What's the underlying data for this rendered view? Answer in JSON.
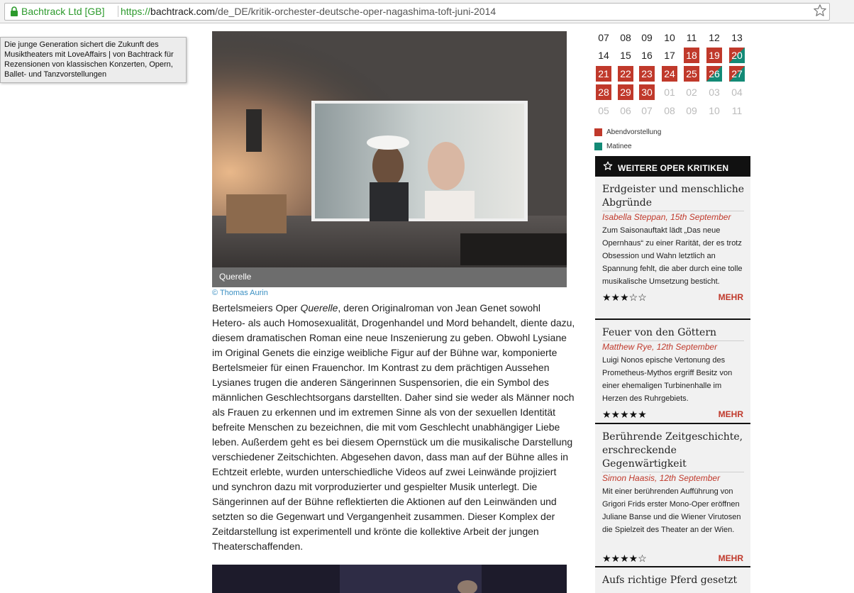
{
  "browser": {
    "ev_label": "Bachtrack Ltd [GB]",
    "url_scheme": "https://",
    "url_host": "bachtrack.com",
    "url_path": "/de_DE/kritik-orchester-deutsche-oper-nagashima-toft-juni-2014"
  },
  "tooltip": "Die junge Generation sichert die Zukunft des Musiktheaters mit LoveAffairs | von Bachtrack für Rezensionen von klassischen Konzerten, Opern, Ballet- und Tanzvorstellungen",
  "article": {
    "image_caption": "Querelle",
    "photo_credit": "© Thomas Aurin",
    "p_start": "Bertelsmeiers Oper ",
    "p_em": "Querelle",
    "p_rest": ", deren Originalroman von Jean Genet sowohl Hetero- als auch Homosexualität, Drogenhandel und Mord behandelt, diente dazu, diesem dramatischen Roman eine neue Inszenierung zu geben. Obwohl Lysiane im Original Genets die einzige weibliche Figur auf der Bühne war, komponierte Bertelsmeier für einen Frauenchor. Im Kontrast zu dem prächtigen Aussehen Lysianes trugen die anderen Sängerinnen Suspensorien, die ein Symbol des männlichen Geschlechtsorgans darstellten. Daher sind sie weder als Männer noch als Frauen zu erkennen und im extremen Sinne als von der sexuellen Identität befreite Menschen zu bezeichnen, die mit vom Geschlecht unabhängiger Liebe leben. Außerdem geht es bei diesem Opernstück um die musikalische Darstellung verschiedener Zeitschichten. Abgesehen davon, dass man auf der Bühne alles in Echtzeit erlebte, wurden unterschiedliche Videos auf zwei Leinwände projiziert und synchron dazu mit vorproduzierter und gespielter Musik unterlegt. Die Sängerinnen auf der Bühne reflektierten die Aktionen auf den Leinwänden und setzten so die Gegenwart und Vergangenheit zusammen. Dieser Komplex der Zeitdarstellung ist experimentell und krönte die kollektive Arbeit der jungen Theaterschaffenden."
  },
  "calendar": {
    "rows": [
      [
        {
          "d": "07",
          "s": "n"
        },
        {
          "d": "08",
          "s": "n"
        },
        {
          "d": "09",
          "s": "n"
        },
        {
          "d": "10",
          "s": "n"
        },
        {
          "d": "11",
          "s": "n"
        },
        {
          "d": "12",
          "s": "n"
        },
        {
          "d": "13",
          "s": "n"
        }
      ],
      [
        {
          "d": "14",
          "s": "n"
        },
        {
          "d": "15",
          "s": "n"
        },
        {
          "d": "16",
          "s": "n"
        },
        {
          "d": "17",
          "s": "n"
        },
        {
          "d": "18",
          "s": "e"
        },
        {
          "d": "19",
          "s": "e"
        },
        {
          "d": "20",
          "s": "x"
        }
      ],
      [
        {
          "d": "21",
          "s": "e"
        },
        {
          "d": "22",
          "s": "e"
        },
        {
          "d": "23",
          "s": "e"
        },
        {
          "d": "24",
          "s": "e"
        },
        {
          "d": "25",
          "s": "e"
        },
        {
          "d": "26",
          "s": "x"
        },
        {
          "d": "27",
          "s": "x"
        }
      ],
      [
        {
          "d": "28",
          "s": "e"
        },
        {
          "d": "29",
          "s": "e"
        },
        {
          "d": "30",
          "s": "e"
        },
        {
          "d": "01",
          "s": "o"
        },
        {
          "d": "02",
          "s": "o"
        },
        {
          "d": "03",
          "s": "o"
        },
        {
          "d": "04",
          "s": "o"
        }
      ],
      [
        {
          "d": "05",
          "s": "o"
        },
        {
          "d": "06",
          "s": "o"
        },
        {
          "d": "07",
          "s": "o"
        },
        {
          "d": "08",
          "s": "o"
        },
        {
          "d": "09",
          "s": "o"
        },
        {
          "d": "10",
          "s": "o"
        },
        {
          "d": "11",
          "s": "o"
        }
      ]
    ],
    "legend_evening": "Abendvorstellung",
    "legend_matinee": "Matinee",
    "color_evening": "#c0392b",
    "color_matinee": "#138a76"
  },
  "sidebar": {
    "header": "WEITERE OPER KRITIKEN",
    "more_label": "MEHR",
    "reviews": [
      {
        "title": "Erdgeister und menschliche Abgründe",
        "author": "Isabella Steppan, 15th September",
        "summary": "Zum Saisonauftakt lädt „Das neue Opernhaus“ zu einer Rarität, der es trotz Obsession und Wahn letztlich an Spannung fehlt, die aber durch eine tolle musikalische Umsetzung besticht.",
        "stars": "★★★☆☆"
      },
      {
        "title": "Feuer von den Göttern",
        "author": "Matthew Rye, 12th September",
        "summary": "Luigi Nonos epische Vertonung des Prometheus-Mythos ergriff Besitz von einer ehemaligen Turbinenhalle im Herzen des Ruhrgebiets.",
        "stars": "★★★★★"
      },
      {
        "title": "Berührende Zeitgeschichte, erschreckende Gegenwärtigkeit",
        "author": "Simon Haasis, 12th September",
        "summary": "Mit einer berührenden Aufführung von Grigori Frids erster Mono-Oper eröffnen Juliane Banse und die Wiener Virutosen die Spielzeit des Theater an der Wien.",
        "stars": "★★★★☆"
      },
      {
        "title": "Aufs richtige Pferd gesetzt"
      }
    ]
  }
}
